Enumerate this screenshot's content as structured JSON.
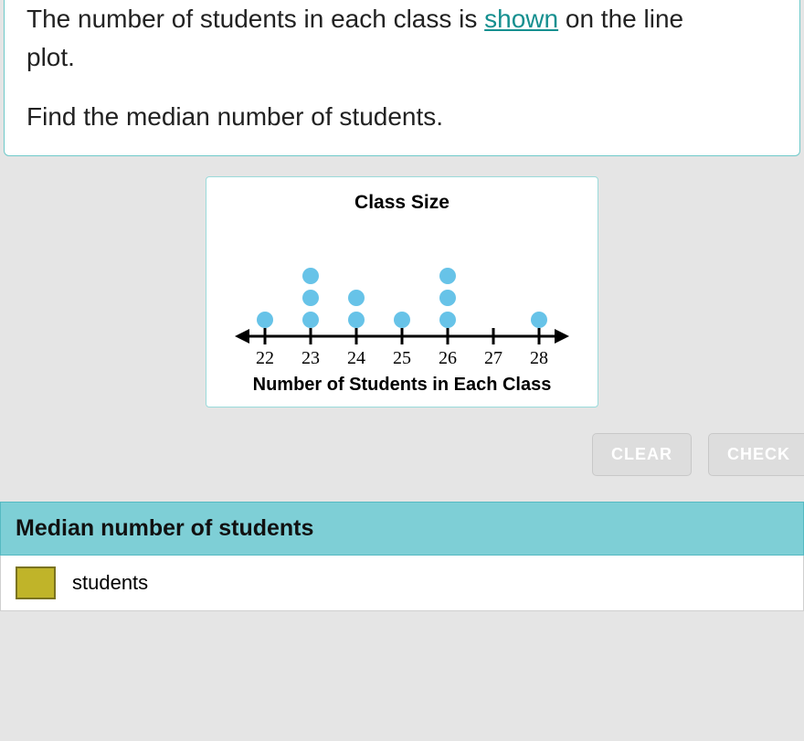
{
  "question": {
    "line1_prefix": "The number of students in each class is ",
    "shown_word": "shown",
    "line1_suffix": " on the line",
    "line2": "plot.",
    "prompt": "Find the median number of students."
  },
  "chart_data": {
    "type": "dotplot",
    "title": "Class Size",
    "xlabel": "Number of Students in Each Class",
    "categories": [
      22,
      23,
      24,
      25,
      26,
      27,
      28
    ],
    "values": [
      1,
      3,
      2,
      1,
      3,
      0,
      1
    ],
    "xlim": [
      22,
      28
    ],
    "dot_color": "#67c3e8"
  },
  "buttons": {
    "clear": "CLEAR",
    "check": "CHECK"
  },
  "answer": {
    "header": "Median number of students",
    "unit": "students",
    "swatch_color": "#c0b429"
  }
}
